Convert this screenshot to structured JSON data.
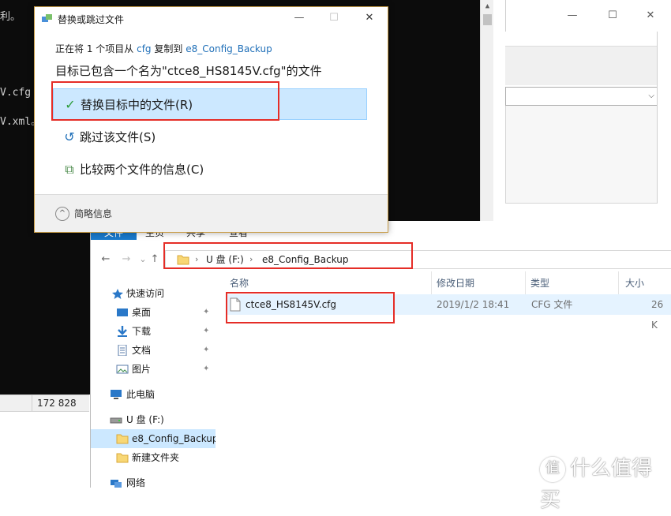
{
  "console": {
    "lines": [
      "利。",
      "V.cfg",
      "V.xml。"
    ]
  },
  "status_strip": {
    "value": "172 828"
  },
  "right_window": {
    "minimize": "—",
    "maximize": "☐",
    "close": "✕",
    "combo_arrow": "⌵"
  },
  "dialog": {
    "title": "替换或跳过文件",
    "minimize": "—",
    "maximize": "☐",
    "close": "✕",
    "subtitle_prefix": "正在将 1 个项目从",
    "subtitle_src": "cfg",
    "subtitle_mid": "复制到",
    "subtitle_dst": "e8_Config_Backup",
    "headline": "目标已包含一个名为\"ctce8_HS8145V.cfg\"的文件",
    "options": [
      {
        "icon": "check-icon",
        "glyph": "✓",
        "label": "替换目标中的文件(R)",
        "color": "#2d9d3a"
      },
      {
        "icon": "skip-arrow-icon",
        "glyph": "↺",
        "label": "跳过该文件(S)",
        "color": "#1f6fb8"
      },
      {
        "icon": "compare-files-icon",
        "glyph": "⧉",
        "label": "比较两个文件的信息(C)",
        "color": "#4a8a4a"
      }
    ],
    "footer_label": "简略信息",
    "footer_glyph": "^"
  },
  "explorer": {
    "tabs": [
      "文件",
      "主页",
      "共享",
      "查看"
    ],
    "nav": {
      "back": "←",
      "forward": "→",
      "recent": "⌄",
      "up": "↑"
    },
    "address": {
      "drive": "U 盘 (F:)",
      "folder": "e8_Config_Backup"
    },
    "columns": {
      "name": "名称",
      "modified": "修改日期",
      "type": "类型",
      "size": "大小",
      "sort_glyph": "^"
    },
    "files": [
      {
        "name": "ctce8_HS8145V.cfg",
        "modified": "2019/1/2 18:41",
        "type": "CFG 文件",
        "size": "26 K"
      }
    ],
    "nav_pane": [
      {
        "label": "快速访问",
        "icon": "star-icon",
        "pinned": false
      },
      {
        "label": "桌面",
        "icon": "desktop-icon",
        "pinned": true
      },
      {
        "label": "下载",
        "icon": "download-icon",
        "pinned": true
      },
      {
        "label": "文档",
        "icon": "document-icon",
        "pinned": true
      },
      {
        "label": "图片",
        "icon": "picture-icon",
        "pinned": true
      },
      {
        "label": "此电脑",
        "icon": "computer-icon",
        "pinned": false
      },
      {
        "label": "U 盘 (F:)",
        "icon": "usb-drive-icon",
        "pinned": false
      },
      {
        "label": "e8_Config_Backup",
        "icon": "folder-icon",
        "pinned": false
      },
      {
        "label": "新建文件夹",
        "icon": "folder-icon",
        "pinned": false
      },
      {
        "label": "网络",
        "icon": "network-icon",
        "pinned": false
      }
    ],
    "pin_glyph": "📌"
  },
  "watermark": {
    "text": "什么值得买",
    "logo_glyph": "值"
  },
  "colors": {
    "highlight_red": "#e52d27",
    "selection_blue": "#cce8ff",
    "file_tab_blue": "#1979ca",
    "link_blue": "#1f6fb8"
  }
}
